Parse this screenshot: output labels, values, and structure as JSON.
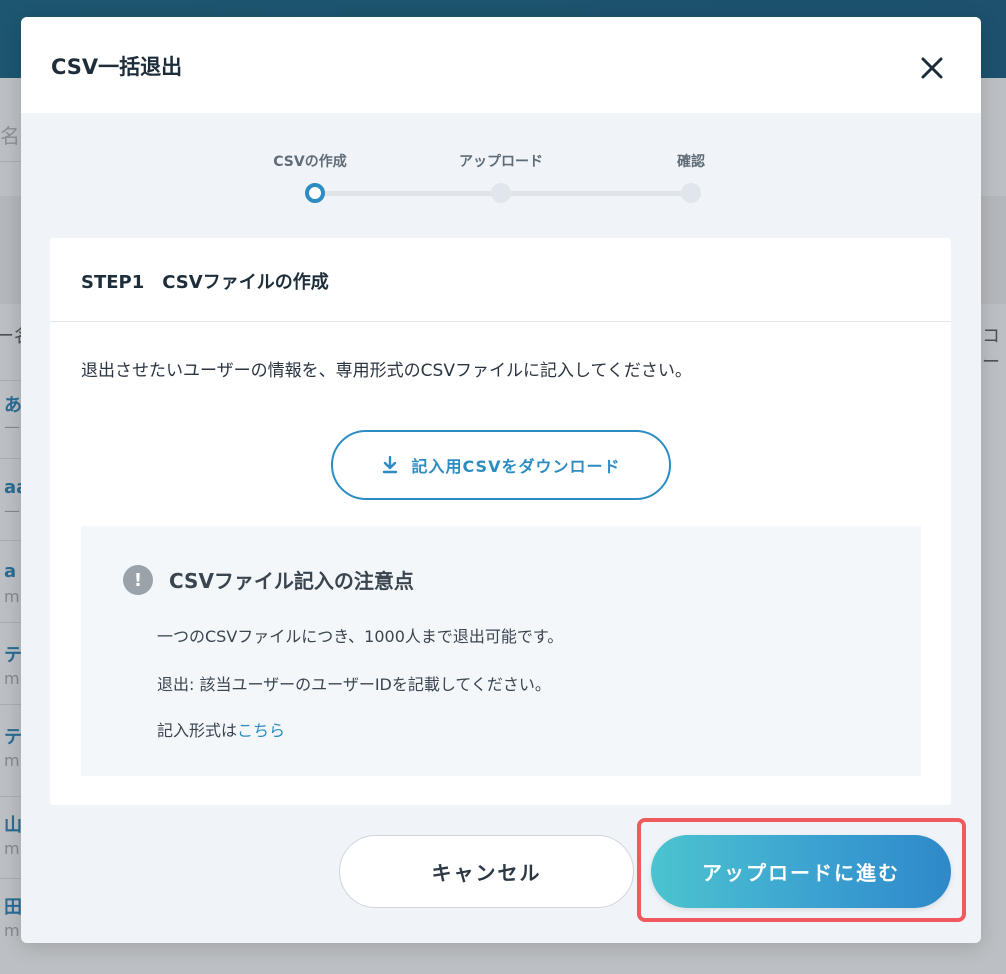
{
  "background": {
    "search_placeholder": "名",
    "column_left": "ー名",
    "column_right": "コー",
    "rows": [
      {
        "name": "あ",
        "sub": "—"
      },
      {
        "name": "aa",
        "sub": "—"
      },
      {
        "name": "a",
        "sub": "m"
      },
      {
        "name": "テ",
        "sub": "m"
      },
      {
        "name": "テ",
        "sub": "m"
      },
      {
        "name": "山",
        "sub": "m"
      },
      {
        "name": "田",
        "sub": "m"
      }
    ]
  },
  "modal": {
    "title": "CSV一括退出",
    "close_icon": "close-icon",
    "stepper": {
      "steps": [
        {
          "label": "CSVの作成",
          "active": true
        },
        {
          "label": "アップロード",
          "active": false
        },
        {
          "label": "確認",
          "active": false
        }
      ]
    },
    "card": {
      "title": "STEP1　CSVファイルの作成",
      "description": "退出させたいユーザーの情報を、専用形式のCSVファイルに記入してください。",
      "download_icon": "download-icon",
      "download_label": "記入用CSVをダウンロード",
      "notes": {
        "icon": "exclamation-icon",
        "title": "CSVファイル記入の注意点",
        "line1": "一つのCSVファイルにつき、1000人まで退出可能です。",
        "line2": "退出: 該当ユーザーのユーザーIDを記載してください。",
        "line3_prefix": "記入形式は",
        "line3_link": "こちら"
      }
    },
    "buttons": {
      "cancel": "キャンセル",
      "next": "アップロードに進む"
    },
    "colors": {
      "accent": "#2d8dc3",
      "highlight": "#ee5a5d"
    }
  }
}
